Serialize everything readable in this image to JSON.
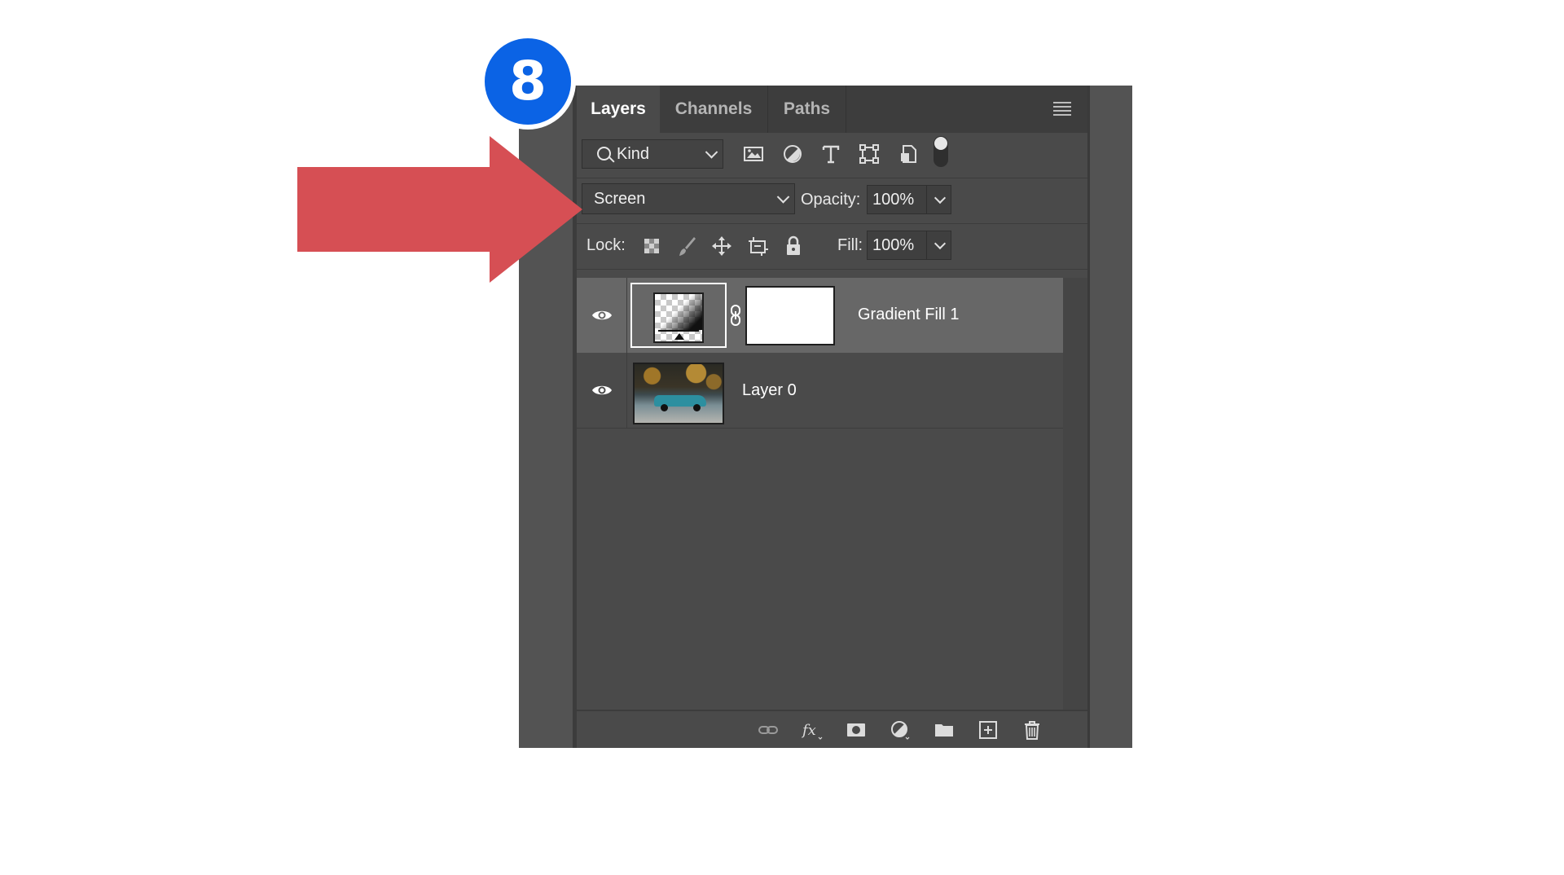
{
  "annotation": {
    "step_number": "8",
    "arrow_color": "#d64f54",
    "badge_color": "#0b63e5"
  },
  "panel": {
    "tabs": [
      {
        "label": "Layers",
        "active": true
      },
      {
        "label": "Channels",
        "active": false
      },
      {
        "label": "Paths",
        "active": false
      }
    ],
    "menu_icon": "panel-menu-icon"
  },
  "filter": {
    "kind_label": "Kind",
    "icons": [
      "image-filter-icon",
      "adjustment-filter-icon",
      "type-filter-icon",
      "shape-filter-icon",
      "smart-object-filter-icon"
    ],
    "toggle": "filter-toggle"
  },
  "blend": {
    "mode": "Screen",
    "opacity_label": "Opacity:",
    "opacity_value": "100%"
  },
  "lock": {
    "label": "Lock:",
    "icons": [
      "lock-transparent-pixels-icon",
      "lock-image-pixels-icon",
      "lock-position-icon",
      "lock-artboard-icon",
      "lock-all-icon"
    ],
    "fill_label": "Fill:",
    "fill_value": "100%"
  },
  "layers": [
    {
      "name": "Gradient Fill 1",
      "selected": true,
      "visible": true
    },
    {
      "name": "Layer 0",
      "selected": false,
      "visible": true
    }
  ],
  "bottom_icons": [
    "link-layers-icon",
    "fx-icon",
    "add-mask-icon",
    "new-adjustment-icon",
    "new-group-icon",
    "new-layer-icon",
    "delete-layer-icon"
  ]
}
